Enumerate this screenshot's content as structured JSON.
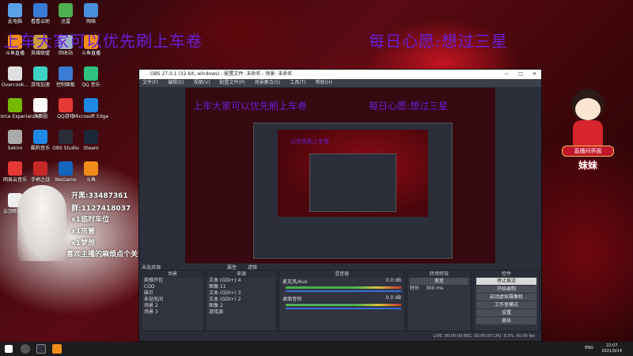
{
  "overlay": {
    "left_title": "上车大家可以优先刷上车卷",
    "right_title": "每日心愿:想过三星",
    "preview_left_title": "上车大家可以优先刷上车卷",
    "preview_right_title": "每日心愿:想过三星",
    "nested_title": "以优先刷上车卷"
  },
  "danmu": [
    "开黑:33487361",
    "群:1127418037",
    "x1临时车位",
    "x1房管",
    "x1梦想",
    "喜欢主播的麻烦点个关注"
  ],
  "desktop_icons": [
    {
      "label": "此电脑",
      "color": "#5aa0e6"
    },
    {
      "label": "看看云助",
      "color": "#3a7bd5"
    },
    {
      "label": "迅雷",
      "color": "#4caf50"
    },
    {
      "label": "网络",
      "color": "#4a8fdc"
    },
    {
      "label": "斗鱼直播",
      "color": "#f08c1a"
    },
    {
      "label": "英雄联盟",
      "color": "#c89b3c"
    },
    {
      "label": "回收站",
      "color": "#9fb3c8"
    },
    {
      "label": "斗鱼直播",
      "color": "#f08c1a"
    },
    {
      "label": "Overcook...",
      "color": "#e0e0e0"
    },
    {
      "label": "游戏加速",
      "color": "#3dd2c4"
    },
    {
      "label": "控制面板",
      "color": "#3a7bd5"
    },
    {
      "label": "QQ 音乐",
      "color": "#2ec27e"
    },
    {
      "label": "GeForce Experience",
      "color": "#76b900"
    },
    {
      "label": "决赛圈",
      "color": "#ffffff"
    },
    {
      "label": "QQ游戏",
      "color": "#e53935"
    },
    {
      "label": "Microsoft Edge",
      "color": "#1e88e5"
    },
    {
      "label": "Sekiro",
      "color": "#aaaaaa"
    },
    {
      "label": "酷狗音乐",
      "color": "#1e88e5"
    },
    {
      "label": "OBS Studio",
      "color": "#2b2e38"
    },
    {
      "label": "Steam",
      "color": "#1b2838"
    },
    {
      "label": "网易云音乐",
      "color": "#e53935"
    },
    {
      "label": "手柄之战",
      "color": "#c62828"
    },
    {
      "label": "WeGame",
      "color": "#1565c0"
    },
    {
      "label": "斗鱼",
      "color": "#f08c1a"
    },
    {
      "label": "云顶新机速",
      "color": "#eeeeee"
    }
  ],
  "obs": {
    "title": "OBS 27.0.1 (32-bit, windows) - 配置文件: 未命名 - 场景: 未命名",
    "menu": [
      "文件(F)",
      "编辑(E)",
      "视图(V)",
      "配置文件(P)",
      "场景集合(S)",
      "工具(T)",
      "帮助(H)"
    ],
    "source_bar_label": "未选择源",
    "source_bar_buttons": [
      "属性",
      "滤镜"
    ],
    "panels": {
      "scenes": {
        "header": "场景",
        "items": [
          "商推开包",
          "COD",
          "麻贝",
          "永劫无间",
          "场景 2",
          "场景 3"
        ]
      },
      "sources": {
        "header": "来源",
        "items": [
          "文本 (GDI+) 4",
          "图像 11",
          "文本 (GDI+) 3",
          "文本 (GDI+) 2",
          "图像 2",
          "游戏源"
        ]
      },
      "mixer": {
        "header": "混音器",
        "rows": [
          {
            "label": "麦克风/Aux",
            "value": "0.0 dB"
          },
          {
            "label": "桌面音频",
            "value": "0.0 dB"
          }
        ]
      },
      "transitions": {
        "header": "转场特效",
        "type": "渐变",
        "duration_label": "时长",
        "duration": "300 ms"
      },
      "controls": {
        "header": "控件",
        "buttons": [
          "停止推流",
          "开始录制",
          "启动虚拟摄像机",
          "工作室模式",
          "设置",
          "退出"
        ]
      }
    },
    "status": "LIVE: 00:00:00   REC: 00:00:00   CPU: 9.5%, 60.00 fps"
  },
  "mascot": {
    "banner": "直播间界面",
    "name": "妹妹"
  },
  "taskbar": {
    "lang": "ENG",
    "time": "22:07",
    "date": "2021/9/14"
  }
}
